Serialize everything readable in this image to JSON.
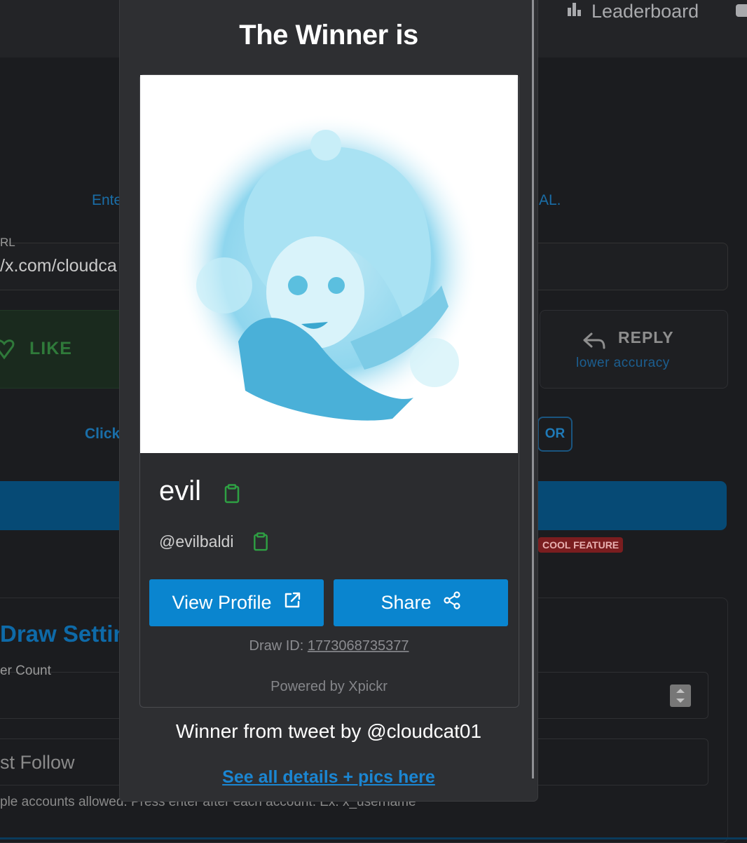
{
  "nav": {
    "leaderboard_label": "Leaderboard",
    "leaderboard_icon": "bar-chart-icon"
  },
  "page": {
    "intro_left": "Ente",
    "intro_right": "AL.",
    "url_label": "RL",
    "url_value": "/x.com/cloudca",
    "like_label": "LIKE",
    "reply_label": "REPLY",
    "reply_sub": "lower accuracy",
    "click_text": "Click",
    "or_label": "OR",
    "cool_feature": "COOL FEATURE",
    "settings_title": "Draw Settin",
    "winner_count_label": "er Count",
    "follow_text": "st Follow",
    "hint_text": "ple accounts allowed. Press enter after each account. Ex: x_username"
  },
  "modal": {
    "title": "The Winner is",
    "winner_name": "evil",
    "winner_handle": "@evilbaldi",
    "view_profile_label": "View Profile",
    "share_label": "Share",
    "draw_id_label": "Draw ID:",
    "draw_id_value": "1773068735377",
    "powered_by": "Powered by Xpickr",
    "winner_from": "Winner from tweet by @cloudcat01",
    "see_all": "See all details + pics here"
  },
  "colors": {
    "accent": "#0a85cf",
    "link": "#1b86d2",
    "copy_icon": "#2ea043",
    "modal_bg": "#2e2f32",
    "page_bg": "#1b1c1f"
  }
}
